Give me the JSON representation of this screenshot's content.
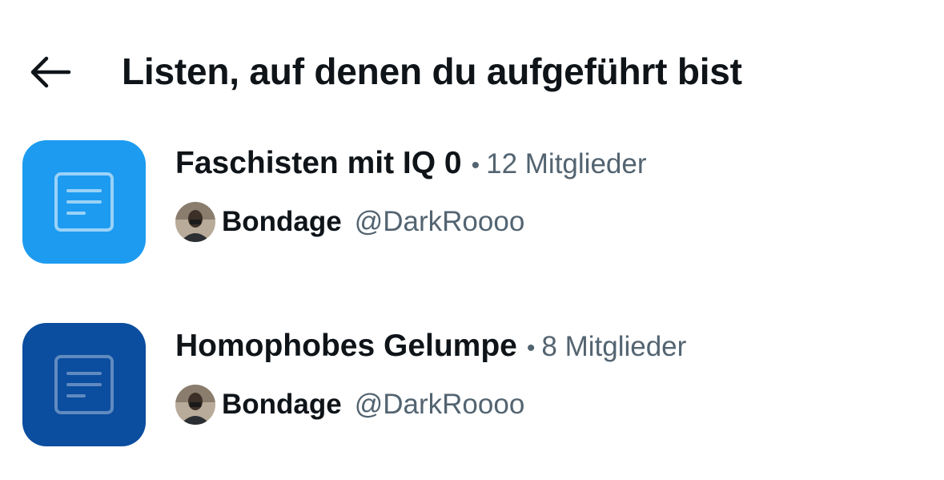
{
  "header": {
    "back_icon": "arrow-left-icon",
    "title": "Listen, auf denen du aufgeführt bist"
  },
  "lists": [
    {
      "name": "Faschisten mit IQ 0",
      "separator": "•",
      "member_count": "12 Mitglieder",
      "icon": "list-document-icon",
      "icon_color": "#1d9bf0",
      "owner": {
        "display_name": "Bondage",
        "handle": "@DarkRoooo"
      }
    },
    {
      "name": "Homophobes Gelumpe",
      "separator": "•",
      "member_count": "8 Mitglieder",
      "icon": "list-document-icon",
      "icon_color": "#0b4d9e",
      "owner": {
        "display_name": "Bondage",
        "handle": "@DarkRoooo"
      }
    }
  ],
  "colors": {
    "text_primary": "#0f1419",
    "text_secondary": "#536471",
    "background": "#ffffff"
  }
}
